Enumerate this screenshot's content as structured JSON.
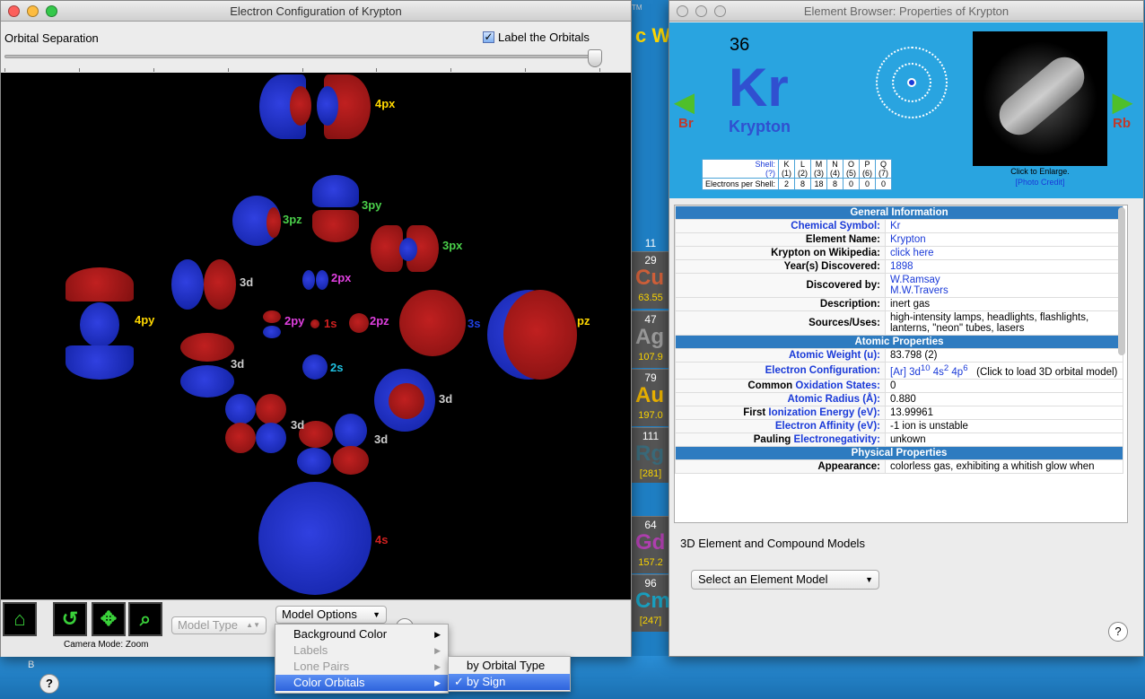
{
  "desktop": {
    "background_title": "c We",
    "trademark": "TM",
    "help_label": "?",
    "bottom_letter": "B",
    "periodic_cells": [
      {
        "number": "11",
        "symbol": "",
        "weight": "",
        "color": "#ffd800"
      },
      {
        "number": "29",
        "symbol": "Cu",
        "weight": "63.55",
        "color": "#d0603a"
      },
      {
        "number": "47",
        "symbol": "Ag",
        "weight": "107.9",
        "color": "#9a9a9a"
      },
      {
        "number": "79",
        "symbol": "Au",
        "weight": "197.0",
        "color": "#e8b000"
      },
      {
        "number": "111",
        "symbol": "Rg",
        "weight": "[281]",
        "color": "#3a6a7a"
      },
      {
        "number": "64",
        "symbol": "Gd",
        "weight": "157.2",
        "color": "#b040b0"
      },
      {
        "number": "96",
        "symbol": "Cm",
        "weight": "[247]",
        "color": "#1aa0c0"
      }
    ]
  },
  "orbital_window": {
    "title": "Electron Configuration of Krypton",
    "separation_label": "Orbital Separation",
    "label_orbitals": "Label the Orbitals",
    "label_orbitals_checked": true,
    "separation_value": 0.99,
    "orbital_labels": [
      {
        "text": "4px",
        "color": "#ffd800"
      },
      {
        "text": "3py",
        "color": "#4ad04a"
      },
      {
        "text": "3pz",
        "color": "#4ad04a"
      },
      {
        "text": "3px",
        "color": "#4ad04a"
      },
      {
        "text": "3d",
        "color": "#cccccc"
      },
      {
        "text": "2px",
        "color": "#e040e0"
      },
      {
        "text": "4py",
        "color": "#ffd800"
      },
      {
        "text": "2py",
        "color": "#e040e0"
      },
      {
        "text": "1s",
        "color": "#d02020"
      },
      {
        "text": "2pz",
        "color": "#e040e0"
      },
      {
        "text": "3s",
        "color": "#2040e0"
      },
      {
        "text": "pz",
        "color": "#ffd800"
      },
      {
        "text": "3d",
        "color": "#cccccc"
      },
      {
        "text": "2s",
        "color": "#20c0e0"
      },
      {
        "text": "3d",
        "color": "#cccccc"
      },
      {
        "text": "3d",
        "color": "#cccccc"
      },
      {
        "text": "3d",
        "color": "#cccccc"
      },
      {
        "text": "4s",
        "color": "#d02020"
      }
    ],
    "toolbar": {
      "camera_mode_label": "Camera Mode:",
      "camera_mode_value": "Zoom",
      "model_type": "Model Type",
      "model_options": "Model Options"
    },
    "options_menu": {
      "items": [
        {
          "label": "Background Color",
          "enabled": true
        },
        {
          "label": "Labels",
          "enabled": false
        },
        {
          "label": "Lone Pairs",
          "enabled": false
        },
        {
          "label": "Color Orbitals",
          "enabled": true,
          "selected": true
        }
      ],
      "submenu": [
        {
          "label": "by Orbital Type",
          "checked": false
        },
        {
          "label": "by Sign",
          "checked": true
        }
      ]
    }
  },
  "browser_window": {
    "title": "Element Browser: Properties of Krypton",
    "atomic_number": "36",
    "symbol": "Kr",
    "name": "Krypton",
    "prev_element": "Br",
    "next_element": "Rb",
    "click_to_enlarge": "Click to Enlarge.",
    "photo_credit": "[Photo Credit]",
    "shell_header_label": "Shell:",
    "shell_sub_label": "(?)",
    "shell_names": [
      "K",
      "L",
      "M",
      "N",
      "O",
      "P",
      "Q"
    ],
    "shell_numbers": [
      "(1)",
      "(2)",
      "(3)",
      "(4)",
      "(5)",
      "(6)",
      "(7)"
    ],
    "electrons_label": "Electrons per Shell:",
    "electrons": [
      "2",
      "8",
      "18",
      "8",
      "0",
      "0",
      "0"
    ],
    "sections": {
      "general": "General Information",
      "atomic": "Atomic Properties",
      "physical": "Physical Properties"
    },
    "general": [
      {
        "key": "Chemical Symbol:",
        "value": "Kr",
        "key_link": true,
        "value_link": true
      },
      {
        "key": "Element Name:",
        "value": "Krypton",
        "key_link": false,
        "value_link": true
      },
      {
        "key": "Krypton on Wikipedia:",
        "value": "click here",
        "key_link": false,
        "value_link": true
      },
      {
        "key": "Year(s) Discovered:",
        "value": "1898",
        "key_link": false,
        "value_link": true
      },
      {
        "key": "Discovered by:",
        "value": "W.Ramsay",
        "value2": "M.W.Travers",
        "key_link": false,
        "value_link": true
      },
      {
        "key": "Description:",
        "value": "inert gas",
        "key_link": false,
        "value_link": false
      },
      {
        "key": "Sources/Uses:",
        "value": "high-intensity lamps, headlights, flashlights, lanterns, \"neon\" tubes, lasers",
        "key_link": false,
        "value_link": false
      }
    ],
    "atomic": {
      "weight_key": "Atomic Weight (u):",
      "weight": "83.798 (2)",
      "config_key": "Electron Configuration:",
      "config_html_parts": [
        "[Ar] 3d",
        "10",
        " 4s",
        "2",
        " 4p",
        "6"
      ],
      "config_note": "(Click to load 3D orbital model)",
      "ox_key_prefix": "Common",
      "ox_key_link": "Oxidation States:",
      "ox": "0",
      "radius_key": "Atomic Radius (Å):",
      "radius": "0.880",
      "ie_key_prefix": "First",
      "ie_key_link": "Ionization Energy (eV):",
      "ie": "13.99961",
      "ea_key": "Electron Affinity (eV):",
      "ea": "-1 ion is unstable",
      "en_key_prefix": "Pauling",
      "en_key_link": "Electronegativity:",
      "en": "unkown"
    },
    "physical": {
      "appearance_key": "Appearance:",
      "appearance": "colorless gas, exhibiting a whitish glow when"
    },
    "models_title": "3D Element and Compound Models",
    "select_model": "Select an Element Model",
    "help_label": "?"
  }
}
